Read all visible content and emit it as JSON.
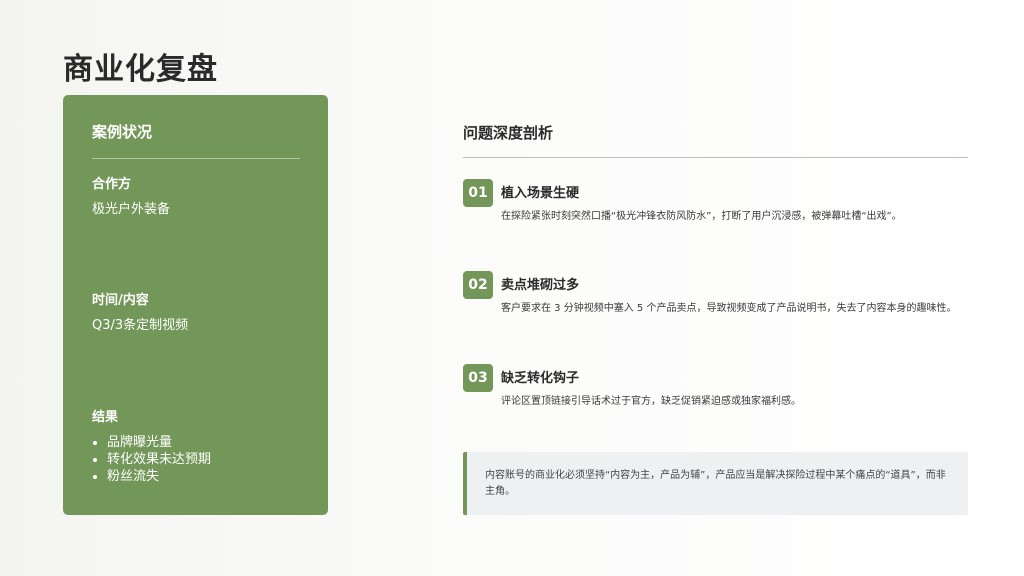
{
  "page": {
    "title": "商业化复盘"
  },
  "case": {
    "title": "案例状况",
    "partner_label": "合作方",
    "partner_value": "极光户外装备",
    "time_label": "时间/内容",
    "time_value": "Q3/3条定制视频",
    "result_label": "结果",
    "results": [
      "品牌曝光量",
      "转化效果未达预期",
      "粉丝流失"
    ]
  },
  "analysis": {
    "title": "问题深度剖析",
    "issues": [
      {
        "num": "01",
        "title": "植入场景生硬",
        "desc": "在探险紧张时刻突然口播“极光冲锋衣防风防水”，打断了用户沉浸感，被弹幕吐槽“出戏”。"
      },
      {
        "num": "02",
        "title": "卖点堆砌过多",
        "desc": "客户要求在 3 分钟视频中塞入 5 个产品卖点，导致视频变成了产品说明书，失去了内容本身的趣味性。"
      },
      {
        "num": "03",
        "title": "缺乏转化钩子",
        "desc": " 评论区置顶链接引导话术过于官方，缺乏促销紧迫感或独家福利感。"
      }
    ],
    "note": "内容账号的商业化必须坚持“内容为主，产品为辅”，产品应当是解决探险过程中某个痛点的“道具”，而非主角。"
  },
  "colors": {
    "accent": "#739758",
    "note_bg": "#eef0f2"
  }
}
